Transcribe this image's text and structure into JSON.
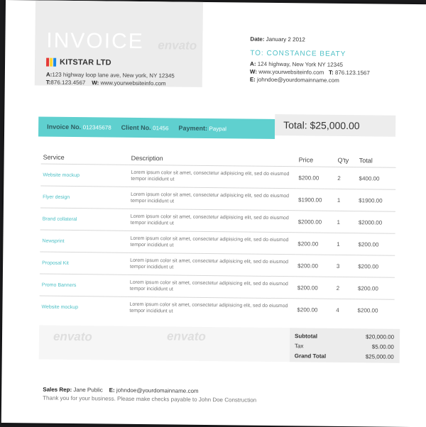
{
  "header": {
    "title": "INVOICE",
    "company": "KITSTAR LTD",
    "logo_colors": [
      "#e53935",
      "#fdd835",
      "#1e88e5"
    ],
    "address_label": "A:",
    "address": "123 highway loop lane ave, New york, NY 12345",
    "phone_label": "T:",
    "phone": "876.123.4567",
    "web_label": "W:",
    "web": "www.yourwebsiteinfo.com",
    "watermark": "envato"
  },
  "date": {
    "label": "Date:",
    "value": "January 2 2012"
  },
  "client": {
    "name": "TO: CONSTANCE BEATY",
    "address_label": "A:",
    "address": "124 highway, New York NY 12345",
    "web_label": "W:",
    "web": "www.yourwebsiteinfo.com",
    "phone_label": "T:",
    "phone": "876.123.1567",
    "email_label": "E:",
    "email": "johndoe@yourdomainname.com"
  },
  "meta_bar": {
    "invoice_label": "Invoice No.",
    "invoice_no": "012345678",
    "client_label": "Client No.",
    "client_no": "01456",
    "payment_label": "Payment:",
    "payment": "Paypal"
  },
  "total_box": "Total: $25,000.00",
  "table": {
    "headers": {
      "service": "Service",
      "description": "Description",
      "price": "Price",
      "qty": "Q'ty",
      "total": "Total"
    },
    "rows": [
      {
        "service": "Website mockup",
        "description": "Lorem ipsum color sit amet, consectetur adipisicing elit, sed do eiusmod tempor incididunt ut",
        "price": "$200.00",
        "qty": "2",
        "total": "$400.00"
      },
      {
        "service": "Flyer design",
        "description": "Lorem ipsum color sit amet, consectetur adipisicing elit, sed do eiusmod tempor incididunt ut",
        "price": "$1900.00",
        "qty": "1",
        "total": "$1900.00"
      },
      {
        "service": "Brand collateral",
        "description": "Lorem ipsum color sit amet, consectetur adipisicing elit, sed do eiusmod tempor incididunt ut",
        "price": "$2000.00",
        "qty": "1",
        "total": "$2000.00"
      },
      {
        "service": "Newsprint",
        "description": "Lorem ipsum color sit amet, consectetur adipisicing elit, sed do eiusmod tempor incididunt ut",
        "price": "$200.00",
        "qty": "1",
        "total": "$200.00"
      },
      {
        "service": "Proposal Kit",
        "description": "Lorem ipsum color sit amet, consectetur adipisicing elit, sed do eiusmod tempor incididunt ut",
        "price": "$200.00",
        "qty": "3",
        "total": "$200.00"
      },
      {
        "service": "Promo Banners",
        "description": "Lorem ipsum color sit amet, consectetur adipisicing elit, sed do eiusmod tempor incididunt ut",
        "price": "$200.00",
        "qty": "2",
        "total": "$200.00"
      },
      {
        "service": "Website mockup",
        "description": "Lorem ipsum color sit amet, consectetur adipisicing elit, sed do eiusmod tempor incididunt ut",
        "price": "$200.00",
        "qty": "4",
        "total": "$200.00"
      }
    ]
  },
  "summary": {
    "subtotal_label": "Subtotal",
    "subtotal": "$20,000.00",
    "tax_label": "Tax",
    "tax": "$5.00.00",
    "grand_label": "Grand Total",
    "grand": "$25,000.00"
  },
  "footer": {
    "rep_label": "Sales Rep:",
    "rep": "Jane Public",
    "email_label": "E:",
    "email": "johndoe@yourdomainname.com",
    "thanks": "Thank you for your business. Please make checks payable to John Doe Construction"
  },
  "colors": {
    "accent": "#5fd0cf",
    "accent_text": "#4fc0c6",
    "panel": "#ececec"
  }
}
